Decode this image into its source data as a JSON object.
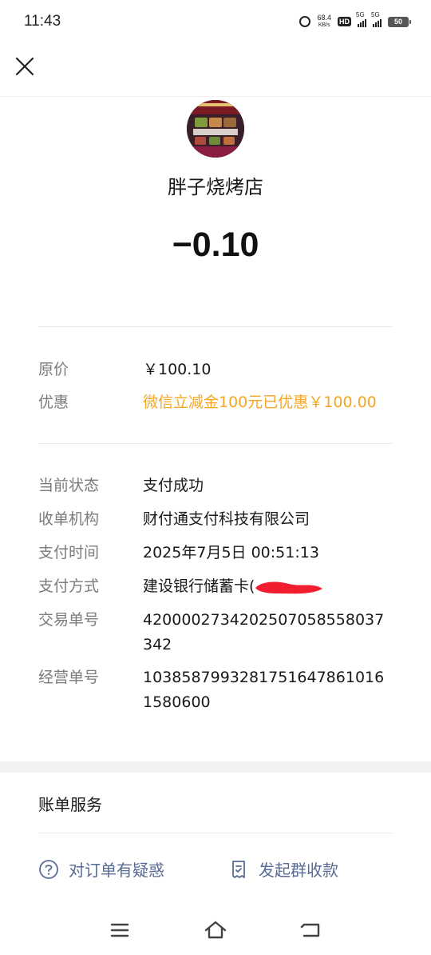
{
  "status_bar": {
    "time": "11:43",
    "net_speed_value": "68.4",
    "net_speed_unit": "KB/s",
    "hd_label": "HD",
    "signal1_label": "5G",
    "signal2_label": "5G",
    "battery": "50"
  },
  "icons": {
    "close": "close-icon",
    "question": "question-circle-icon",
    "receipt": "receipt-icon",
    "menu": "menu-icon",
    "home": "home-icon",
    "back": "back-icon"
  },
  "merchant": {
    "name": "胖子烧烤店",
    "amount": "−0.10"
  },
  "pricing": {
    "original_label": "原价",
    "original_value": "￥100.10",
    "discount_label": "优惠",
    "discount_value": "微信立减金100元已优惠￥100.00"
  },
  "details": {
    "status_label": "当前状态",
    "status_value": "支付成功",
    "institution_label": "收单机构",
    "institution_value": "财付通支付科技有限公司",
    "time_label": "支付时间",
    "time_value": "2025年7月5日 00:51:13",
    "method_label": "支付方式",
    "method_value": "建设银行储蓄卡(",
    "txn_label": "交易单号",
    "txn_value": "4200002734202507058558037342",
    "biz_label": "经营单号",
    "biz_value": "103858799328175164786101615806​00"
  },
  "services": {
    "title": "账单服务",
    "question_order": "对订单有疑惑",
    "group_collect": "发起群收款"
  },
  "colors": {
    "accent_orange": "#f5a623",
    "link_blue": "#576b95",
    "label_gray": "#7b7b7b"
  }
}
